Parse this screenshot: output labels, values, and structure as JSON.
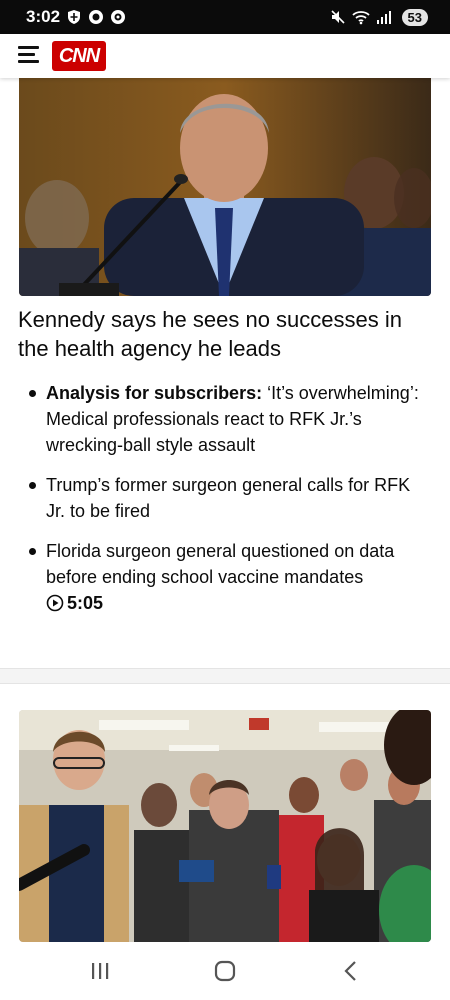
{
  "status_bar": {
    "time": "3:02",
    "battery": "53",
    "icons": [
      "shield-icon",
      "circle-icon",
      "circle-icon",
      "mute-icon",
      "wifi-icon",
      "signal-icon",
      "battery-icon"
    ]
  },
  "header": {
    "logo_text": "CNN",
    "menu_icon": "hamburger-menu-icon",
    "logo_color": "#cc0000"
  },
  "story": {
    "headline": "Kennedy says he sees no successes in the health agency he leads",
    "bullets": [
      {
        "prefix": "Analysis for subscribers:",
        "text": " ‘It’s overwhelming’: Medical professionals react to RFK Jr.’s wrecking-ball style assault"
      },
      {
        "text": "Trump’s former surgeon general calls for RFK Jr. to be fired"
      },
      {
        "text": "Florida surgeon general questioned on data before ending school vaccine mandates ",
        "video_duration": "5:05"
      }
    ]
  },
  "images": {
    "hero": "Man in suit and blue tie seated at hearing microphone",
    "second": "Woman walking surrounded by reporters holding phones"
  },
  "nav_bar": {
    "icons": [
      "recent-apps-icon",
      "home-icon",
      "back-icon"
    ]
  }
}
